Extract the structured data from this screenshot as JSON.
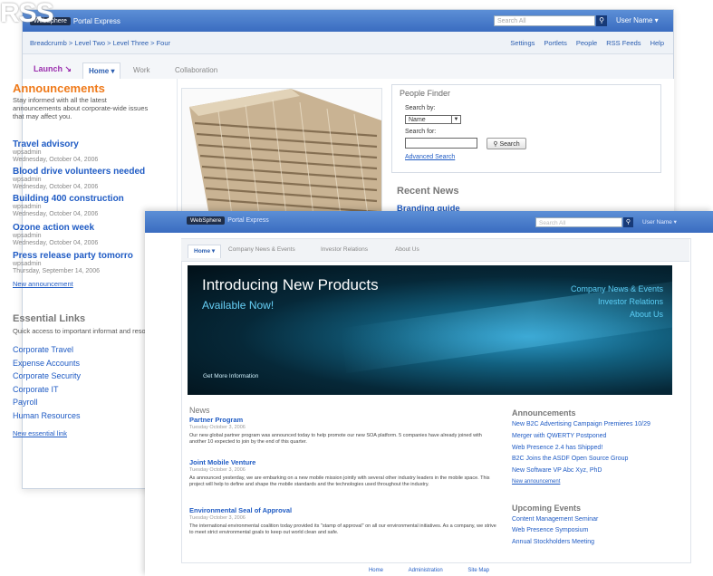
{
  "back_window": {
    "brand": {
      "logo": "WebSphere",
      "product": "Portal Express"
    },
    "search_placeholder": "Search All",
    "search_icon": "magnifier-icon",
    "user_menu": "User Name ▾",
    "breadcrumb": "Breadcrumb > Level Two > Level Three > Four",
    "top_links": [
      "Settings",
      "Portlets",
      "People",
      "RSS Feeds",
      "Help"
    ],
    "launch_label": "Launch ↘",
    "tabs": [
      "Home ▾",
      "Work",
      "Collaboration"
    ],
    "announcements": {
      "title": "Announcements",
      "description": "Stay informed with all the latest announcements about corporate-wide issues that may affect you.",
      "items": [
        {
          "title": "Travel advisory",
          "author": "wpsadmin",
          "date": "Wednesday, October 04, 2006"
        },
        {
          "title": "Blood drive volunteers needed",
          "author": "wpsadmin",
          "date": "Wednesday, October 04, 2006"
        },
        {
          "title": "Building 400 construction",
          "author": "wpsadmin",
          "date": "Wednesday, October 04, 2006"
        },
        {
          "title": "Ozone action week",
          "author": "wpsadmin",
          "date": "Wednesday, October 04, 2006"
        },
        {
          "title": "Press release party tomorro",
          "author": "wpsadmin",
          "date": "Thursday, September 14, 2006"
        }
      ],
      "new_link": "New announcement"
    },
    "essential_links": {
      "title": "Essential Links",
      "description": "Quick access to important informat and resources.",
      "items": [
        "Corporate Travel",
        "Expense Accounts",
        "Corporate Security",
        "Corporate IT",
        "Payroll",
        "Human Resources"
      ],
      "new_link": "New essential link"
    },
    "people_finder": {
      "title": "People Finder",
      "search_by_label": "Search by:",
      "search_by_value": "Name",
      "search_for_label": "Search for:",
      "search_for_value": "",
      "search_button": "Search",
      "advanced_link": "Advanced Search"
    },
    "recent_news": {
      "title": "Recent News",
      "first_item": "Branding guide"
    }
  },
  "overlay_text": "RSS",
  "front_window": {
    "brand": {
      "logo": "WebSphere",
      "product": "Portal Express"
    },
    "search_placeholder": "Search All",
    "user_menu": "User Name ▾",
    "tabs": [
      "Home ▾",
      "Company News & Events",
      "Investor Relations",
      "About Us"
    ],
    "hero": {
      "headline": "Introducing New Products",
      "subhead": "Available Now!",
      "links": [
        "Company News & Events",
        "Investor Relations",
        "About Us"
      ],
      "more": "Get More Information"
    },
    "news": {
      "title": "News",
      "items": [
        {
          "title": "Partner Program",
          "date": "Tuesday October 3, 2006",
          "body": "Our new global partner program was announced today to help promote our new SOA platform. 5 companies have already joined with another 10 expected to join by the end of this quarter."
        },
        {
          "title": "Joint Mobile Venture",
          "date": "Tuesday October 3, 2006",
          "body": "As announced yesterday, we are embarking on a new mobile mission jointly with several other industry leaders in the mobile space. This project will help to define and shape the mobile standards and the technologies used throughout the industry."
        },
        {
          "title": "Environmental Seal of Approval",
          "date": "Tuesday October 3, 2006",
          "body": "The international environmental coalition today provided its \"stamp of approval\" on all our environmental initiatives. As a company, we strive to meet strict environmental goals to keep out world clean and safe."
        }
      ]
    },
    "announcements": {
      "title": "Announcements",
      "items": [
        "New B2C Advertising Campaign Premieres 10/29",
        "Merger with QWERTY Postponed",
        "Web Presence 2.4 has Shipped!",
        "B2C Joins the ASDF Open Source Group",
        "New Software VP Abc Xyz, PhD"
      ],
      "new_link": "New announcement"
    },
    "upcoming_events": {
      "title": "Upcoming Events",
      "items": [
        "Content Management Seminar",
        "Web Presence Symposium",
        "Annual Stockholders Meeting"
      ]
    },
    "footer": [
      "Home",
      "Administration",
      "Site Map"
    ]
  },
  "colors": {
    "header_blue": "#3a6cc0",
    "link_blue": "#1f5bc4",
    "announce_orange": "#ef7a1a",
    "launch_purple": "#9b2fae",
    "hero_cyan": "#5ccff7"
  }
}
